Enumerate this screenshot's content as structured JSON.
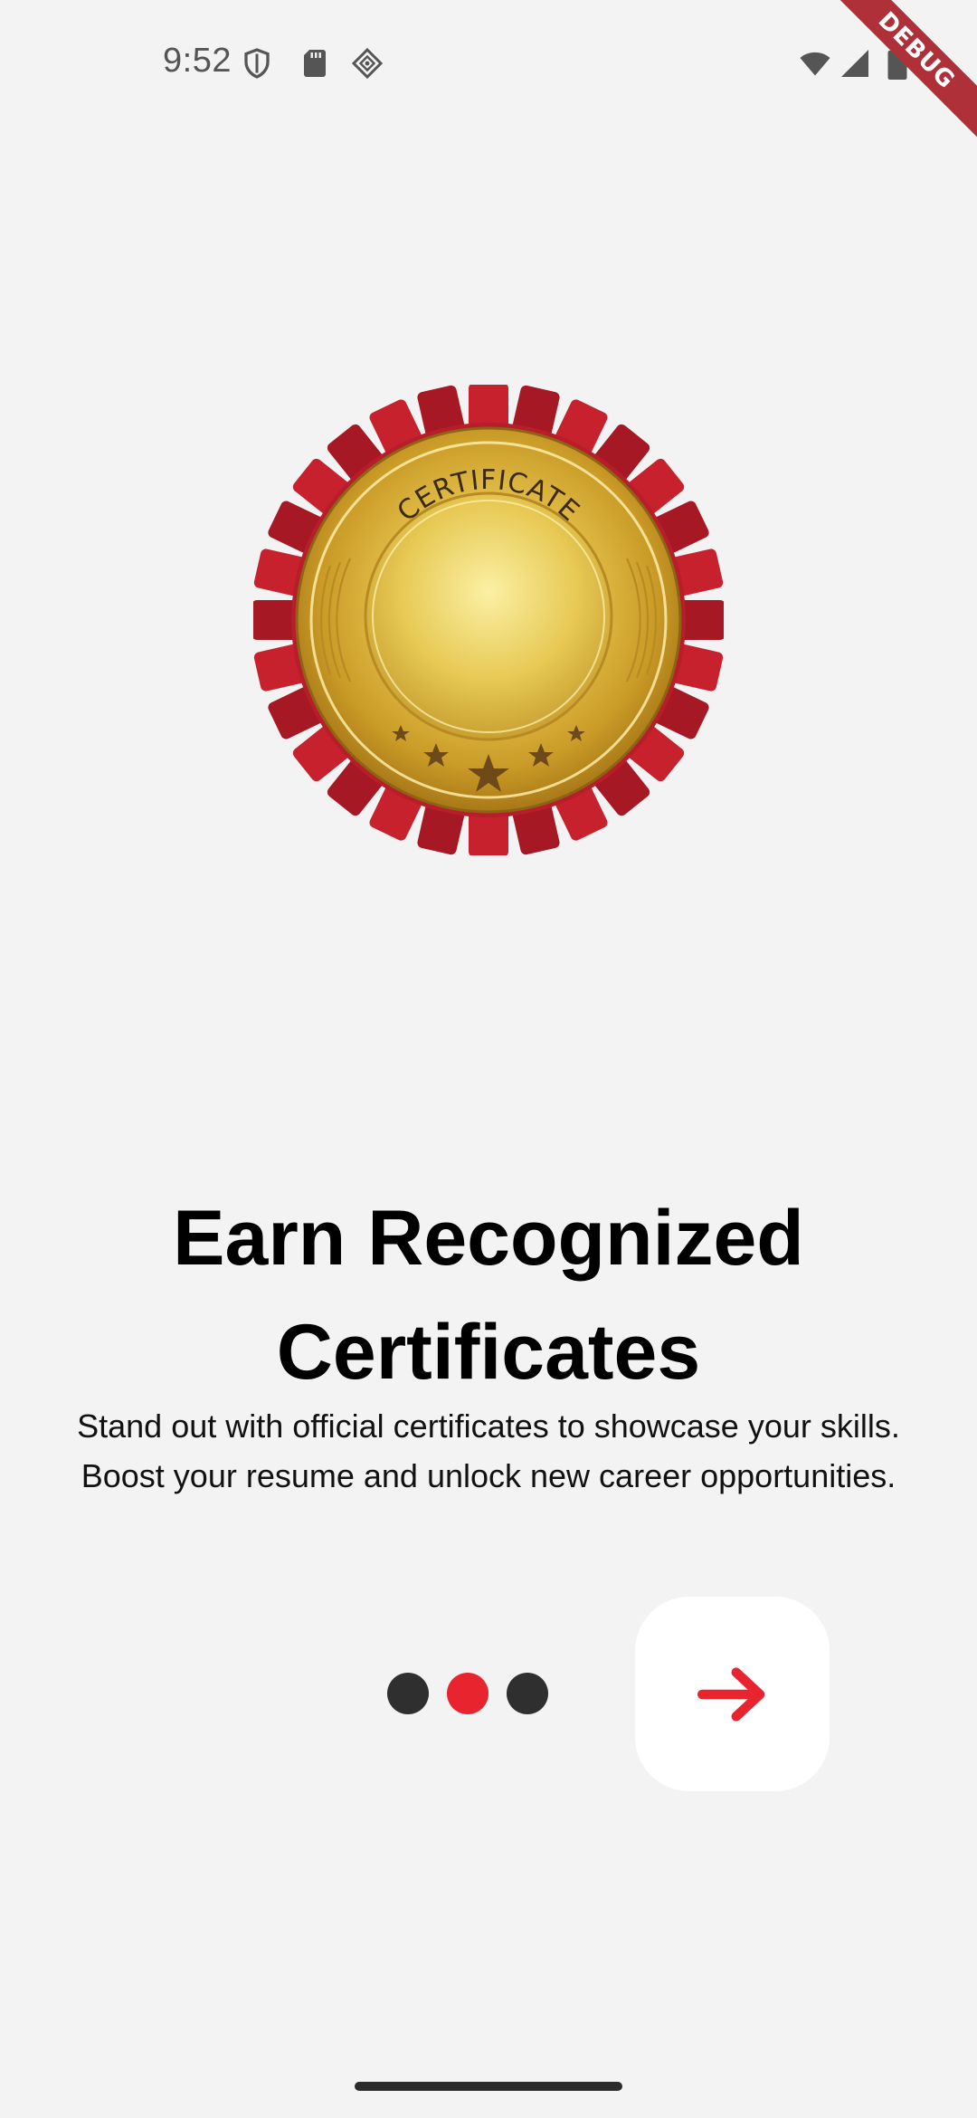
{
  "status_bar": {
    "time": "9:52",
    "left_icons": [
      "shield-icon",
      "sd-card-icon",
      "diamond-icon"
    ],
    "right_icons": [
      "wifi-icon",
      "cellular-signal-icon",
      "battery-icon"
    ]
  },
  "debug_banner": {
    "label": "DEBUG"
  },
  "hero": {
    "icon": "certificate-medal-icon",
    "medal_text": "CERTIFICATE",
    "colors": {
      "ribbon": "#c8212e",
      "gold": "#e3c04a"
    }
  },
  "onboarding": {
    "title": "Earn Recognized Certificates",
    "subtitle_line1": "Stand out with official certificates to showcase your skills.",
    "subtitle_line2": "Boost your resume and unlock new career opportunities.",
    "page_indicator": {
      "total": 3,
      "active_index": 2
    },
    "next_button_icon": "arrow-right-icon",
    "colors": {
      "accent": "#e8242e",
      "dot_inactive": "#2f2f2f",
      "background": "#f3f3f3"
    }
  }
}
